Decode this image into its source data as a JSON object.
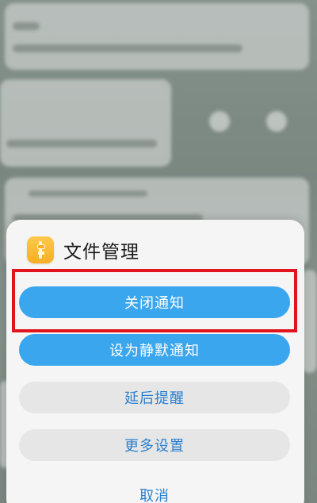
{
  "sheet": {
    "app_name": "文件管理",
    "app_icon": "file-manager-icon",
    "accent_color": "#3aa6ee",
    "highlight_color": "#e0141c"
  },
  "actions": {
    "close_notifications": "关闭通知",
    "silent_notifications": "设为静默通知",
    "remind_later": "延后提醒",
    "more_settings": "更多设置",
    "cancel": "取消"
  }
}
